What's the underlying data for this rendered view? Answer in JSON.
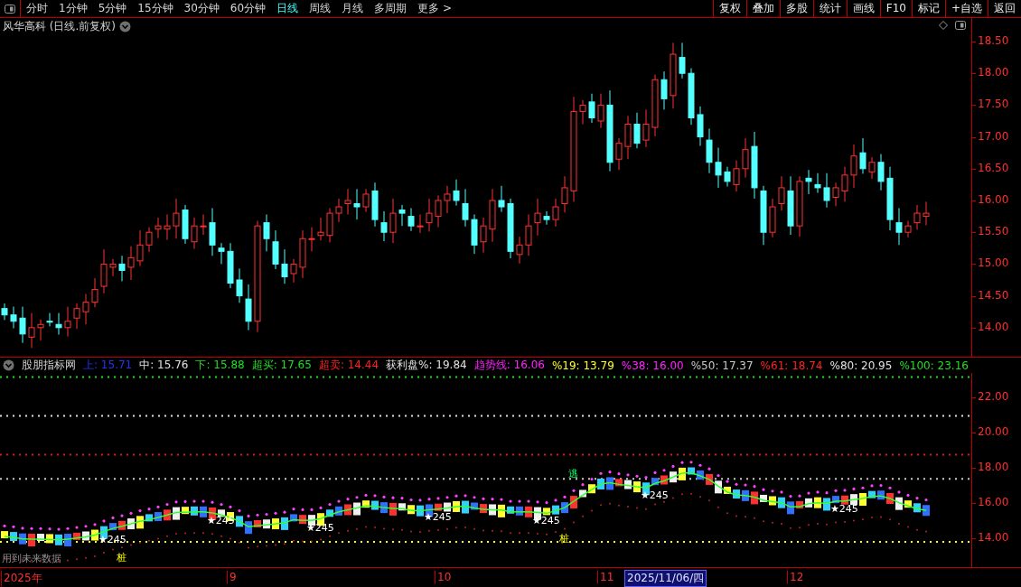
{
  "toolbar": {
    "periods": [
      {
        "label": "分时",
        "selected": false
      },
      {
        "label": "1分钟",
        "selected": false
      },
      {
        "label": "5分钟",
        "selected": false
      },
      {
        "label": "15分钟",
        "selected": false
      },
      {
        "label": "30分钟",
        "selected": false
      },
      {
        "label": "60分钟",
        "selected": false
      },
      {
        "label": "日线",
        "selected": true
      },
      {
        "label": "周线",
        "selected": false
      },
      {
        "label": "月线",
        "selected": false
      },
      {
        "label": "多周期",
        "selected": false
      },
      {
        "label": "更多 >",
        "selected": false
      }
    ],
    "actions": [
      "复权",
      "叠加",
      "多股",
      "统计",
      "画线",
      "F10",
      "标记",
      "+自选",
      "返回"
    ]
  },
  "main_chart": {
    "title": "风华高科 (日线.前复权)",
    "price_axis": [
      "18.50",
      "18.00",
      "17.50",
      "17.00",
      "16.50",
      "16.00",
      "15.50",
      "15.00",
      "14.50",
      "14.00"
    ]
  },
  "indicator": {
    "name": "股朋指标网",
    "legend": [
      {
        "text": "上: 15.71",
        "color": "#2233ff"
      },
      {
        "text": "中: 15.76",
        "color": "#e0e0e0"
      },
      {
        "text": "下: 15.88",
        "color": "#22dd22"
      },
      {
        "text": "超买: 17.65",
        "color": "#22dd22"
      },
      {
        "text": "超卖: 14.44",
        "color": "#ff2222"
      },
      {
        "text": "获利盘%: 19.84",
        "color": "#e0e0e0"
      },
      {
        "text": "趋势线: 16.06",
        "color": "#ff22ff"
      },
      {
        "text": "%19: 13.79",
        "color": "#ffff22"
      },
      {
        "text": "%38: 16.00",
        "color": "#ff22ff"
      },
      {
        "text": "%50: 17.37",
        "color": "#c8c8c8"
      },
      {
        "text": "%61: 18.74",
        "color": "#ff2222"
      },
      {
        "text": "%80: 20.95",
        "color": "#e0e0e0"
      },
      {
        "text": "%100: 23.16",
        "color": "#22dd22"
      }
    ],
    "axis": [
      "22.00",
      "20.00",
      "18.00",
      "16.00",
      "14.00"
    ],
    "signals": [
      {
        "text": "★245",
        "kind": "star"
      },
      {
        "text": "桩",
        "kind": "pile"
      },
      {
        "text": "★245",
        "kind": "star"
      },
      {
        "text": "★245",
        "kind": "star"
      },
      {
        "text": "★245",
        "kind": "star"
      },
      {
        "text": "★245",
        "kind": "star"
      },
      {
        "text": "桩",
        "kind": "pile"
      },
      {
        "text": "逃",
        "kind": "escape"
      },
      {
        "text": "★245",
        "kind": "star"
      },
      {
        "text": "★245",
        "kind": "star"
      }
    ],
    "note": "用到未来数据"
  },
  "date_axis": [
    {
      "label": "2025年",
      "selected": false
    },
    {
      "label": "9",
      "selected": false
    },
    {
      "label": "10",
      "selected": false
    },
    {
      "label": "11",
      "selected": false
    },
    {
      "label": "2025/11/06/四",
      "selected": true
    },
    {
      "label": "12",
      "selected": false
    }
  ]
}
